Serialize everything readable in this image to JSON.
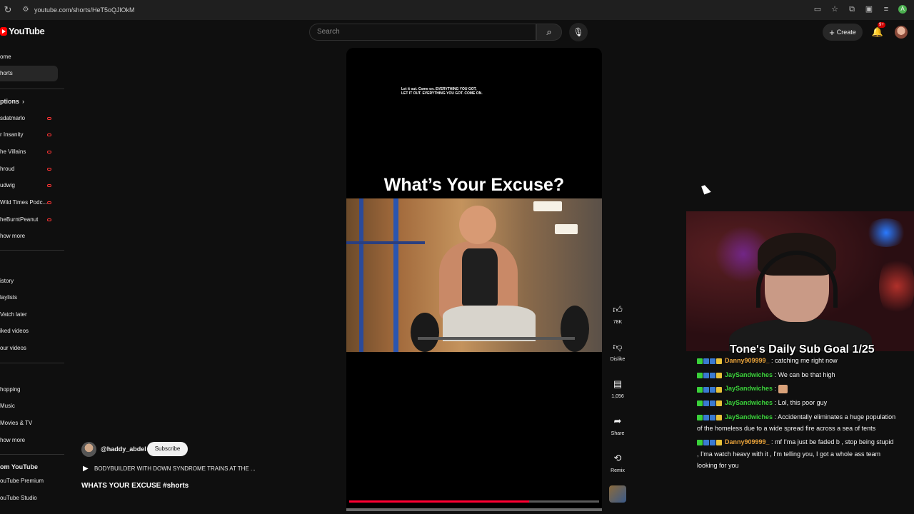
{
  "browser": {
    "url": "youtube.com/shorts/HeT5oQJlOkM",
    "profile_initial": "A"
  },
  "header": {
    "logo_text": "YouTube",
    "search_placeholder": "Search",
    "create_label": "Create",
    "notif_badge": "9+"
  },
  "sidebar": {
    "home": "ome",
    "shorts": "horts",
    "subscriptions_header": "ptions",
    "channels": [
      "sdatmarlo",
      "r Insanity",
      "he Villains",
      "hroud",
      "udwig",
      "Wild Times Podc...",
      "heBurntPeanut"
    ],
    "show_more_1": "how more",
    "you_items": [
      "istory",
      "laylists",
      "Vatch later",
      "iked videos",
      "our videos"
    ],
    "explore_items": [
      "hopping",
      "Music",
      "Movies & TV"
    ],
    "show_more_2": "how more",
    "more_header": "om YouTube",
    "more_items": [
      "ouTube Premium",
      "ouTube Studio"
    ]
  },
  "player": {
    "caption_text": "Let it out. Come on. EVERYTHING YOU GOT,\nLET IT OUT. EVERYTHING YOU GOT. COME ON.",
    "headline": "What’s Your Excuse?",
    "progress": 0.72
  },
  "actions": {
    "like_count": "78K",
    "dislike_label": "Dislike",
    "comment_count": "1,056",
    "share_label": "Share",
    "remix_label": "Remix"
  },
  "channel": {
    "handle": "@haddy_abdel",
    "subscribe_label": "Subscribe",
    "video_title": "BODYBUILDER WITH DOWN SYNDROME TRAINS AT THE ...",
    "video_subtitle": "WHATS YOUR EXCUSE #shorts"
  },
  "stream_overlay": {
    "sub_goal": "Tone's Daily Sub Goal 1/25"
  },
  "chat": {
    "messages": [
      {
        "user": "Danny909999_",
        "user_color": "#e8a23a",
        "text": "catching me right now"
      },
      {
        "user": "JaySandwiches",
        "user_color": "#3ad13a",
        "text": "We can be that high"
      },
      {
        "user": "JaySandwiches",
        "user_color": "#3ad13a",
        "text": "",
        "emote": true
      },
      {
        "user": "JaySandwiches",
        "user_color": "#3ad13a",
        "text": "Lol, this poor guy"
      },
      {
        "user": "JaySandwiches",
        "user_color": "#3ad13a",
        "text": "Accidentally eliminates a huge population of the homeless due to a wide spread fire across a sea of tents"
      },
      {
        "user": "Danny909999_",
        "user_color": "#e8a23a",
        "text": "mf I'ma just be faded b , stop being stupid , I'ma watch heavy with it , I'm telling you, I got a whole ass team looking for you"
      }
    ]
  }
}
